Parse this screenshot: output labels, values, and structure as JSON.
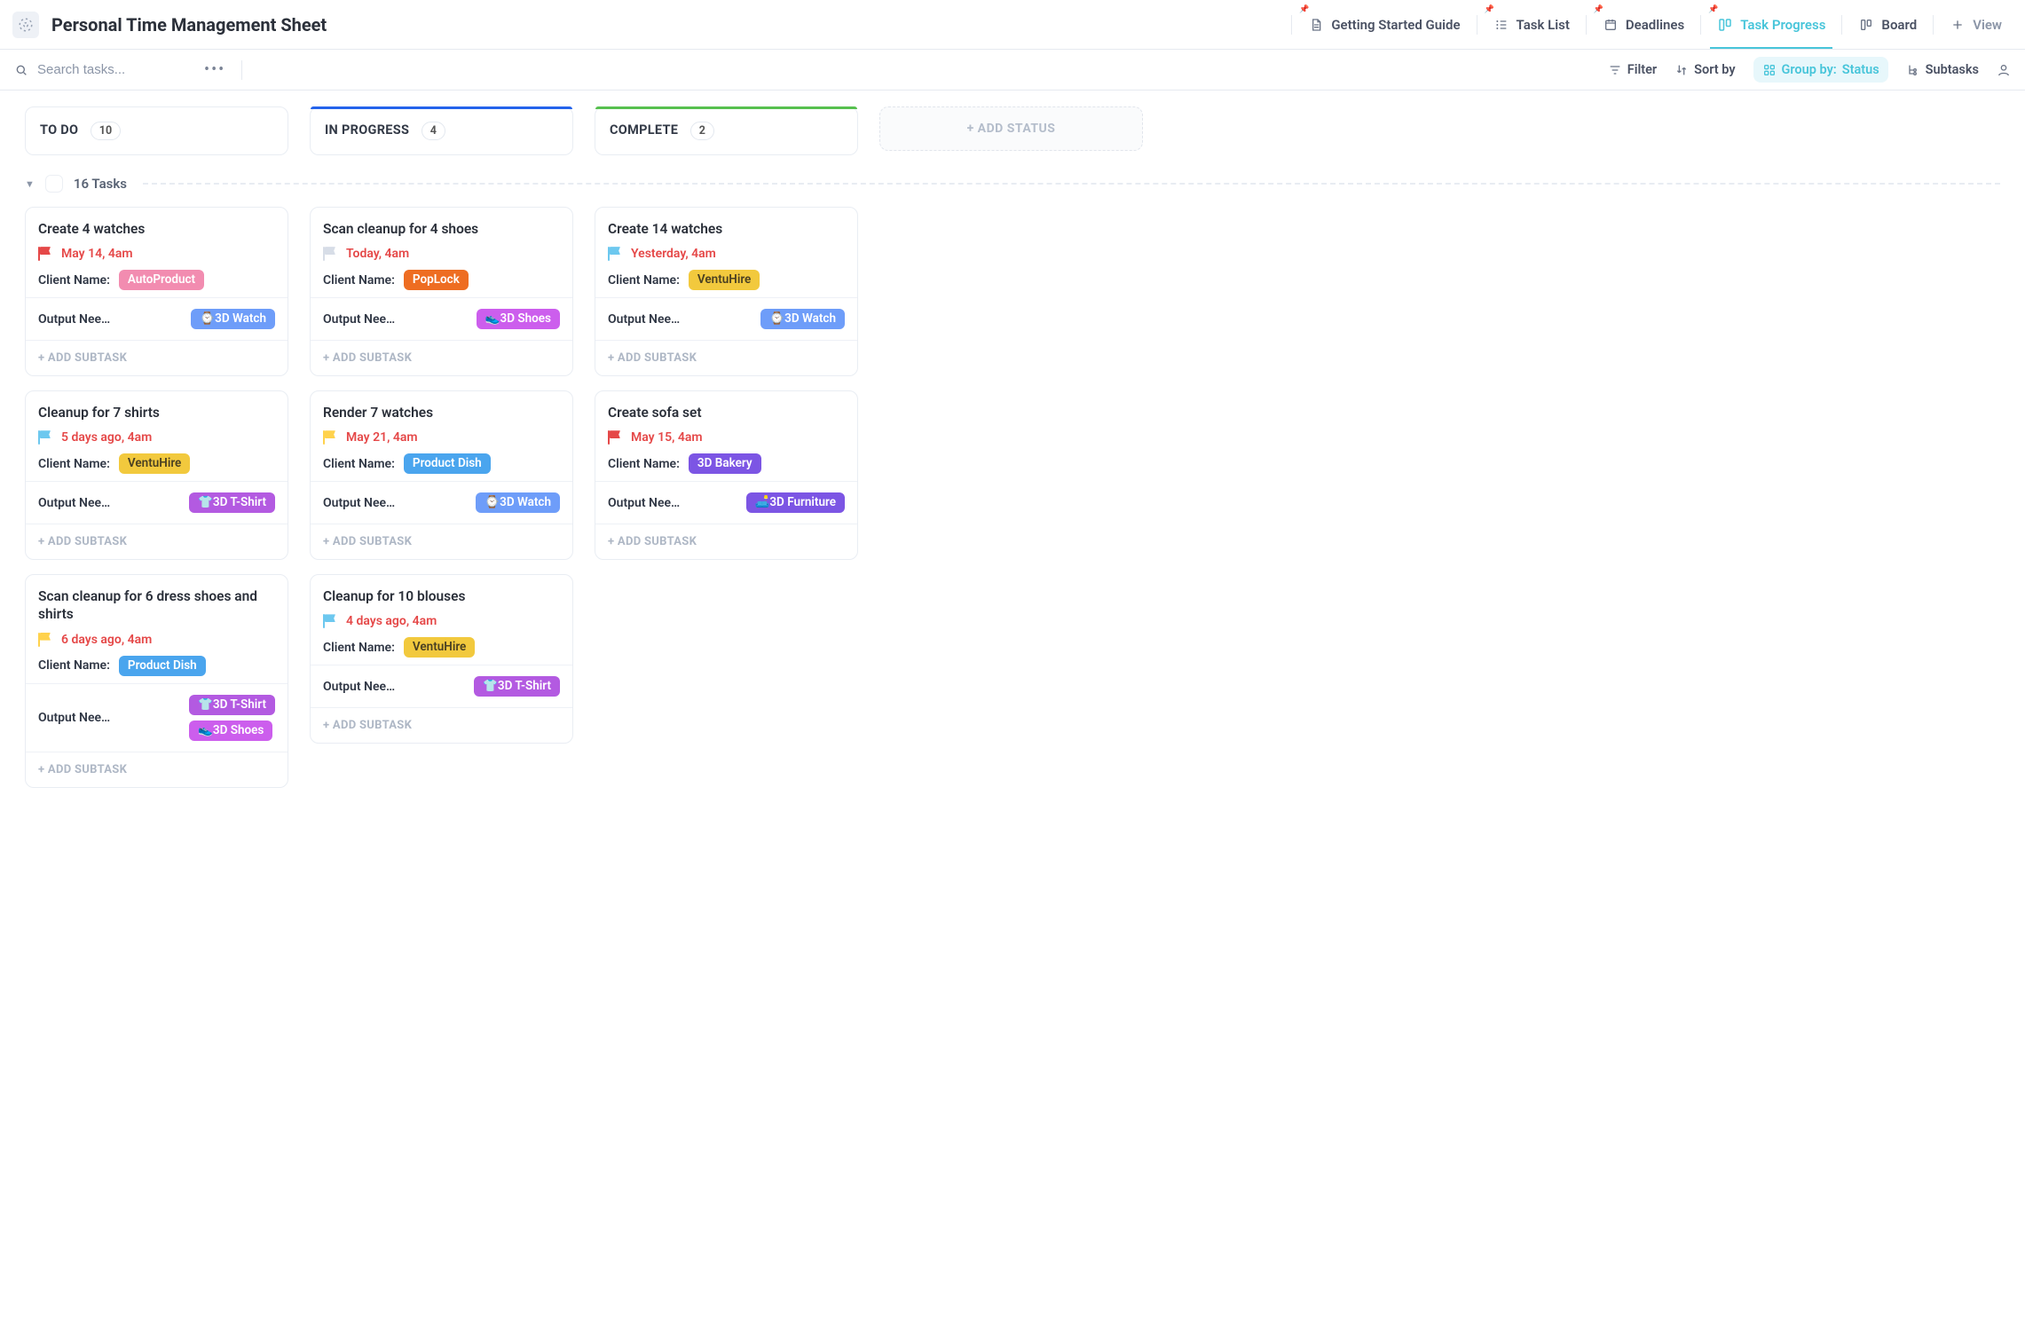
{
  "app": {
    "title": "Personal Time Management Sheet"
  },
  "views": {
    "guide": "Getting Started Guide",
    "tasks": "Task List",
    "deadlines": "Deadlines",
    "progress": "Task Progress",
    "board": "Board",
    "add": "View"
  },
  "toolbar": {
    "search_placeholder": "Search tasks...",
    "filter": "Filter",
    "sortby": "Sort by",
    "groupby_label": "Group by:",
    "groupby_value": "Status",
    "subtasks": "Subtasks"
  },
  "columns": {
    "todo": {
      "title": "TO DO",
      "count": "10"
    },
    "inprogress": {
      "title": "IN PROGRESS",
      "count": "4"
    },
    "complete": {
      "title": "COMPLETE",
      "count": "2"
    },
    "add": "+ ADD STATUS"
  },
  "section": {
    "title": "16 Tasks"
  },
  "labels": {
    "client": "Client Name:",
    "output": "Output Nee…",
    "add_subtask": "+ ADD SUBTASK"
  },
  "cards": {
    "todo": [
      {
        "title": "Create 4 watches",
        "flag": "red",
        "due": "May 14, 4am",
        "client_tag": {
          "text": "AutoProduct",
          "color": "pink"
        },
        "output_tags": [
          {
            "text": "3D Watch",
            "emoji": "⌚",
            "color": "blue"
          }
        ]
      },
      {
        "title": "Cleanup for 7 shirts",
        "flag": "sky",
        "due": "5 days ago, 4am",
        "client_tag": {
          "text": "VentuHire",
          "color": "yellow"
        },
        "output_tags": [
          {
            "text": "3D T-Shirt",
            "emoji": "👕",
            "color": "purple"
          }
        ]
      },
      {
        "title": "Scan cleanup for 6 dress shoes and shirts",
        "flag": "yellow",
        "due": "6 days ago, 4am",
        "client_tag": {
          "text": "Product Dish",
          "color": "sky"
        },
        "output_tags": [
          {
            "text": "3D T-Shirt",
            "emoji": "👕",
            "color": "purple"
          },
          {
            "text": "3D Shoes",
            "emoji": "👟",
            "color": "magenta"
          }
        ]
      }
    ],
    "inprogress": [
      {
        "title": "Scan cleanup for 4 shoes",
        "flag": "grey",
        "due": "Today, 4am",
        "client_tag": {
          "text": "PopLock",
          "color": "orange"
        },
        "output_tags": [
          {
            "text": "3D Shoes",
            "emoji": "👟",
            "color": "magenta"
          }
        ]
      },
      {
        "title": "Render 7 watches",
        "flag": "yellow",
        "due": "May 21, 4am",
        "client_tag": {
          "text": "Product Dish",
          "color": "sky"
        },
        "output_tags": [
          {
            "text": "3D Watch",
            "emoji": "⌚",
            "color": "blue"
          }
        ]
      },
      {
        "title": "Cleanup for 10 blouses",
        "flag": "sky",
        "due": "4 days ago, 4am",
        "client_tag": {
          "text": "VentuHire",
          "color": "yellow"
        },
        "output_tags": [
          {
            "text": "3D T-Shirt",
            "emoji": "👕",
            "color": "purple"
          }
        ]
      }
    ],
    "complete": [
      {
        "title": "Create 14 watches",
        "flag": "sky",
        "due": "Yesterday, 4am",
        "client_tag": {
          "text": "VentuHire",
          "color": "yellow"
        },
        "output_tags": [
          {
            "text": "3D Watch",
            "emoji": "⌚",
            "color": "blue"
          }
        ]
      },
      {
        "title": "Create sofa set",
        "flag": "red",
        "due": "May 15, 4am",
        "client_tag": {
          "text": "3D Bakery",
          "color": "violet"
        },
        "output_tags": [
          {
            "text": "3D Furniture",
            "emoji": "🛋️",
            "color": "violet"
          }
        ]
      }
    ]
  }
}
